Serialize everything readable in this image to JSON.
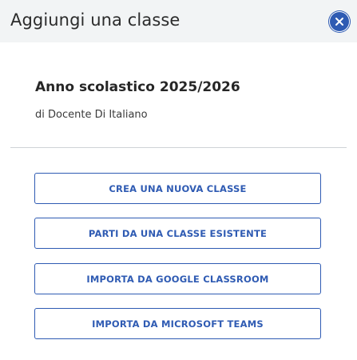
{
  "dialog": {
    "title": "Aggiungi una classe",
    "close_icon": "close-icon",
    "accent_color": "#2f5bb3"
  },
  "school_year": {
    "title": "Anno scolastico 2025/2026",
    "teacher": "di Docente Di Italiano"
  },
  "actions": [
    {
      "label": "CREA UNA NUOVA CLASSE"
    },
    {
      "label": "PARTI DA UNA CLASSE ESISTENTE"
    },
    {
      "label": "IMPORTA DA GOOGLE CLASSROOM"
    },
    {
      "label": "IMPORTA DA MICROSOFT TEAMS"
    }
  ]
}
